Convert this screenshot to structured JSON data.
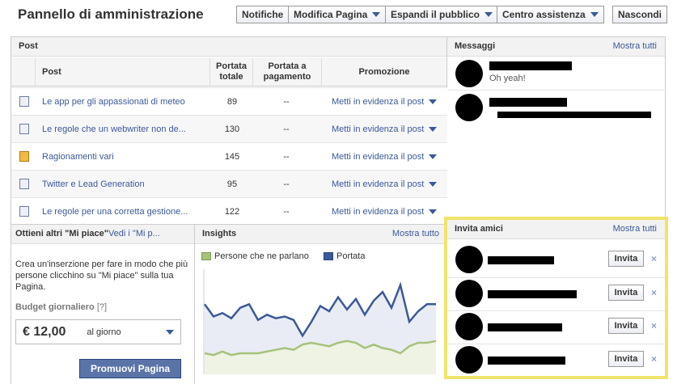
{
  "header": {
    "title": "Pannello di amministrazione",
    "buttons": [
      "Notifiche",
      "Modifica Pagina",
      "Espandi il pubblico",
      "Centro assistenza",
      "Nascondi"
    ]
  },
  "posts": {
    "section_title": "Post",
    "columns": {
      "post": "Post",
      "reach": "Portata totale",
      "paid": "Portata a pagamento",
      "promo": "Promozione"
    },
    "rows": [
      {
        "title": "Le app per gli appassionati di meteo",
        "reach": "89",
        "paid": "--",
        "promo": "Metti in evidenza il post"
      },
      {
        "title": "Le regole che un webwriter non de...",
        "reach": "130",
        "paid": "--",
        "promo": "Metti in evidenza il post"
      },
      {
        "title": "Ragionamenti vari",
        "reach": "145",
        "paid": "--",
        "promo": "Metti in evidenza il post"
      },
      {
        "title": "Twitter e Lead Generation",
        "reach": "95",
        "paid": "--",
        "promo": "Metti in evidenza il post"
      },
      {
        "title": "Le regole per una corretta gestione...",
        "reach": "122",
        "paid": "--",
        "promo": "Metti in evidenza il post"
      }
    ]
  },
  "messages": {
    "title": "Messaggi",
    "show_all": "Mostra tutti",
    "items": [
      {
        "preview": "Oh yeah!"
      }
    ]
  },
  "likes": {
    "title": "Ottieni altri \"Mi piace\"",
    "link": "Vedi i \"Mi p...",
    "description": "Crea un'inserzione per fare in modo che più persone clicchino su \"Mi piace\" sulla tua Pagina.",
    "budget_label": "Budget giornaliero",
    "budget_help": "[?]",
    "budget_value": "€ 12,00",
    "budget_period": "al giorno",
    "promote_button": "Promuovi Pagina"
  },
  "insights": {
    "title": "Insights",
    "show_all": "Mostra tutto",
    "legend": [
      {
        "name": "Persone che ne parlano",
        "color": "#a6c27a"
      },
      {
        "name": "Portata",
        "color": "#3b5998"
      }
    ]
  },
  "invite": {
    "title": "Invita amici",
    "show_all": "Mostra tutti",
    "button_label": "Invita",
    "remove": "×",
    "count": 4,
    "highlight_color": "#f2e36b"
  },
  "chart_data": {
    "type": "area",
    "series": [
      {
        "name": "Portata",
        "values": [
          40,
          33,
          35,
          32,
          38,
          40,
          31,
          34,
          32,
          33,
          31,
          22,
          30,
          39,
          36,
          44,
          37,
          43,
          34,
          42,
          47,
          38,
          51,
          30,
          36,
          40,
          40
        ]
      },
      {
        "name": "Persone che ne parlano",
        "values": [
          12,
          11,
          13,
          11,
          12,
          12,
          12,
          13,
          14,
          15,
          14,
          17,
          18,
          17,
          16,
          18,
          19,
          18,
          15,
          17,
          15,
          14,
          12,
          16,
          18,
          18,
          19
        ]
      }
    ]
  }
}
